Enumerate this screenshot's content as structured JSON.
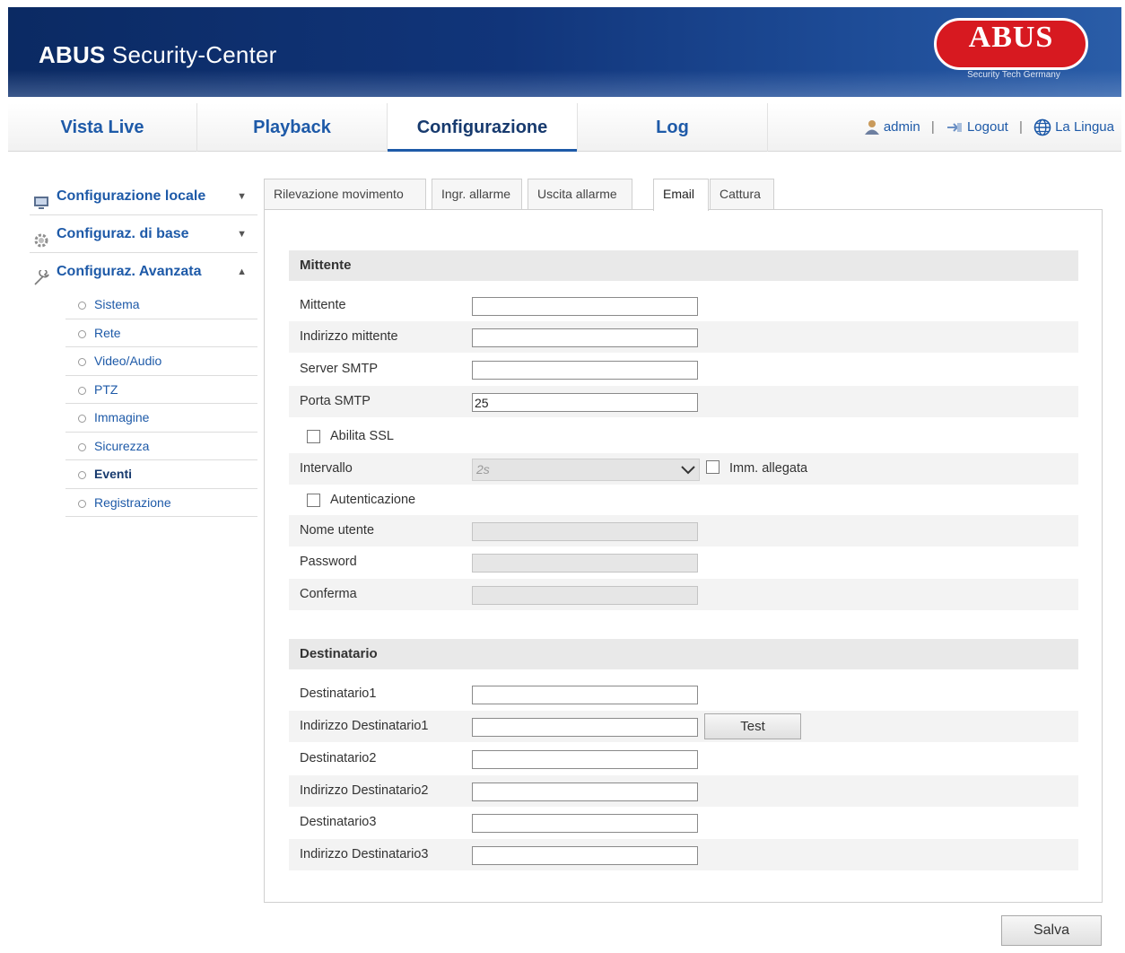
{
  "header": {
    "title_bold": "ABUS",
    "title_rest": " Security-Center",
    "logo_text": "ABUS",
    "logo_subtext": "Security Tech Germany"
  },
  "nav": {
    "tabs": [
      {
        "label": "Vista Live"
      },
      {
        "label": "Playback"
      },
      {
        "label": "Configurazione"
      },
      {
        "label": "Log"
      }
    ],
    "active_tab": "Configurazione",
    "user": "admin",
    "logout": "Logout",
    "language": "La Lingua"
  },
  "sidebar": {
    "groups": [
      {
        "label": "Configurazione locale",
        "expanded": false
      },
      {
        "label": "Configuraz. di base",
        "expanded": false
      },
      {
        "label": "Configuraz. Avanzata",
        "expanded": true
      }
    ],
    "items": [
      "Sistema",
      "Rete",
      "Video/Audio",
      "PTZ",
      "Immagine",
      "Sicurezza",
      "Eventi",
      "Registrazione"
    ],
    "active_item": "Eventi"
  },
  "content_tabs": [
    "Rilevazione movimento",
    "Ingr. allarme",
    "Uscita allarme",
    "Email",
    "Cattura"
  ],
  "active_content_tab": "Email",
  "sender_section": {
    "title": "Mittente",
    "fields": {
      "sender": {
        "label": "Mittente",
        "value": ""
      },
      "sender_address": {
        "label": "Indirizzo mittente",
        "value": ""
      },
      "smtp_server": {
        "label": "Server SMTP",
        "value": ""
      },
      "smtp_port": {
        "label": "Porta SMTP",
        "value": "25"
      }
    },
    "enable_ssl": {
      "label": "Abilita SSL",
      "checked": false
    },
    "interval": {
      "label": "Intervallo",
      "value": "2s"
    },
    "attach_image": {
      "label": "Imm. allegata",
      "checked": false
    },
    "authentication": {
      "label": "Autenticazione",
      "checked": false
    },
    "username": {
      "label": "Nome utente",
      "value": ""
    },
    "password": {
      "label": "Password",
      "value": ""
    },
    "confirm": {
      "label": "Conferma",
      "value": ""
    }
  },
  "recipient_section": {
    "title": "Destinatario",
    "rows": [
      {
        "label": "Destinatario1",
        "value": ""
      },
      {
        "label": "Indirizzo Destinatario1",
        "value": ""
      },
      {
        "label": "Destinatario2",
        "value": ""
      },
      {
        "label": "Indirizzo Destinatario2",
        "value": ""
      },
      {
        "label": "Destinatario3",
        "value": ""
      },
      {
        "label": "Indirizzo Destinatario3",
        "value": ""
      }
    ],
    "test_button": "Test"
  },
  "save_button": "Salva",
  "colors": {
    "brand_red": "#d71920",
    "header_blue": "#11357a",
    "link_blue": "#1e5aa8"
  }
}
